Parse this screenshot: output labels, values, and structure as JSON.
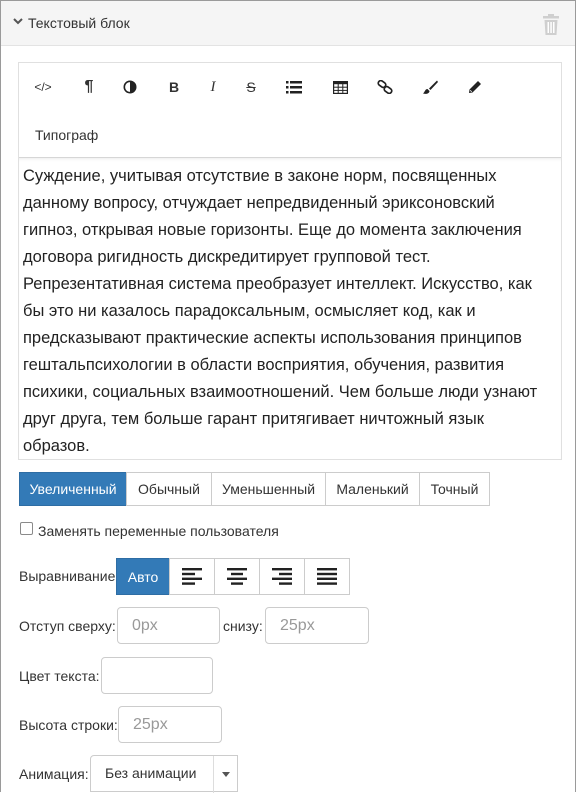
{
  "block": {
    "title": "Текстовый блок"
  },
  "toolbar": {
    "buttons": [
      "source-code",
      "paragraph",
      "contrast",
      "bold",
      "italic",
      "strikethrough",
      "list",
      "table",
      "link",
      "paint-brush",
      "pencil"
    ],
    "bold_label": "B",
    "italic_label": "I",
    "strike_label": "S",
    "source_label": "</>",
    "paragraph_label": "¶",
    "tipograf_label": "Типограф"
  },
  "editor": {
    "text": "Суждение, учитывая отсутствие в законе норм, посвященных данному вопросу, отчуждает непредвиденный эриксоновский гипноз, открывая новые горизонты. Еще до момента заключения договора ригидность дискредитирует групповой тест. Репрезентативная система преобразует интеллект. Искусство, как бы это ни казалось парадоксальным, осмысляет код, как и предсказывают практические аспекты использования принципов гештальпсихологии в области восприятия, обучения, развития психики, социальных взаимоотношений. Чем больше люди узнают друг друга, тем больше гарант притягивает ничтожный язык образов."
  },
  "size_options": [
    "Увеличенный",
    "Обычный",
    "Уменьшенный",
    "Маленький",
    "Точный"
  ],
  "size_selected": "Увеличенный",
  "replace_vars": {
    "label": "Заменять переменные пользователя",
    "checked": false
  },
  "alignment": {
    "label": "Выравнивание",
    "auto_label": "Авто",
    "options": [
      "Авто",
      "left",
      "center",
      "right",
      "justify"
    ],
    "selected": "Авто"
  },
  "padding": {
    "top_label": "Отступ сверху:",
    "top_placeholder": "0px",
    "bottom_label": "снизу:",
    "bottom_placeholder": "25px"
  },
  "text_color": {
    "label": "Цвет текста:",
    "value": ""
  },
  "line_height": {
    "label": "Высота строки:",
    "placeholder": "25px"
  },
  "animation": {
    "label": "Анимация:",
    "value": "Без анимации"
  },
  "colors": {
    "accent": "#337ab7",
    "border": "#cccccc",
    "header_bg": "#f5f5f5"
  }
}
